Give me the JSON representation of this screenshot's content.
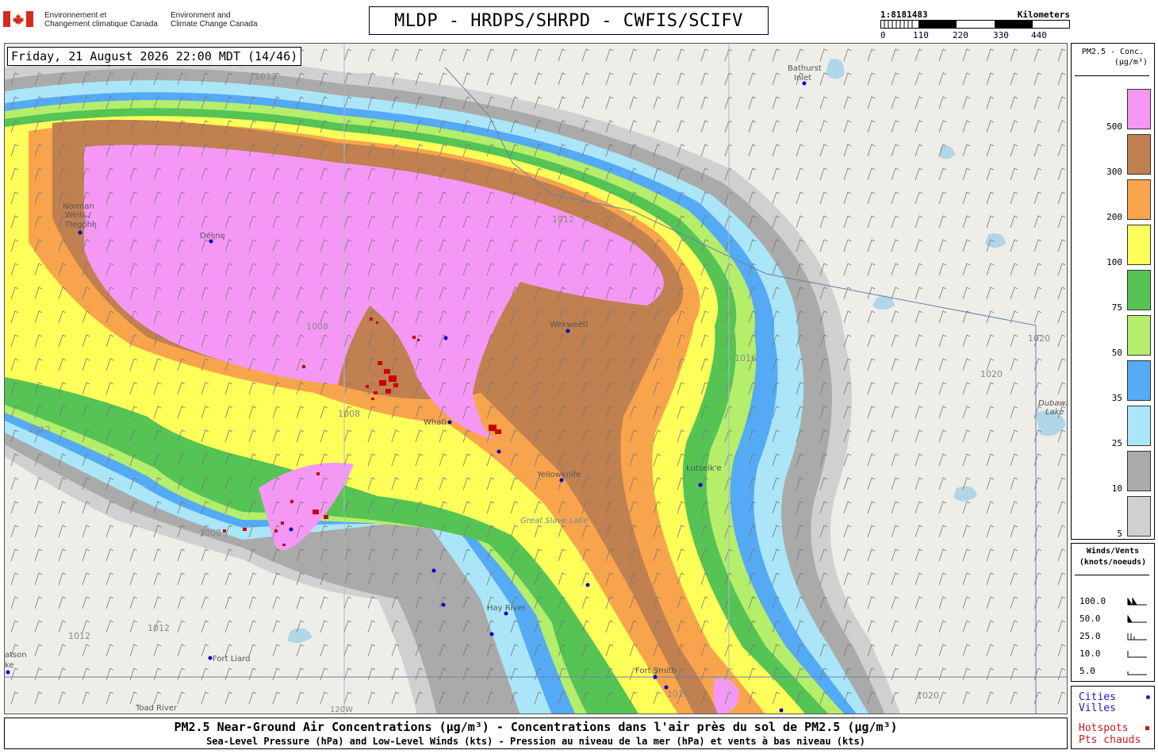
{
  "header": {
    "dept_fr_line1": "Environnement et",
    "dept_fr_line2": "Changement climatique Canada",
    "dept_en_line1": "Environment and",
    "dept_en_line2": "Climate Change Canada",
    "model_title": "MLDP - HRDPS/SHRPD - CWFIS/SCIFV"
  },
  "scale": {
    "ratio": "1:8181483",
    "unit": "Kilometers",
    "ticks": [
      "0",
      "110",
      "220",
      "330",
      "440"
    ]
  },
  "map": {
    "valid_time": "Friday, 21 August 2026 22:00 MDT (14/46)",
    "cities": [
      {
        "name": "Bathurst Inlet",
        "line1": "Bathurst",
        "line2": "Inlet"
      },
      {
        "name": "Norman Wells / Tłegǫ́hłı̨",
        "line1": "Norman",
        "line2": "Wells /",
        "line3": "Tłegǫ́hłı̨"
      },
      {
        "name": "Délı̨nę"
      },
      {
        "name": "Wekweètì"
      },
      {
        "name": "Whatì"
      },
      {
        "name": "Yellowknife"
      },
      {
        "name": "Łutselk'e"
      },
      {
        "name": "Hay River"
      },
      {
        "name": "Fort Liard"
      },
      {
        "name": "Fort Smith"
      },
      {
        "name": "Toad River"
      },
      {
        "name": "Dubawnt Lake",
        "line1": "Dubawnt",
        "line2": "Lake"
      },
      {
        "name": "Great Slave Lake"
      },
      {
        "name": "Watson Lake",
        "line1": "atson",
        "line2": "ke"
      }
    ],
    "isobars": [
      "1012",
      "1008",
      "1016",
      "1020"
    ],
    "meridian_label": "120W",
    "colors": {
      "land": "#efede8",
      "water": "#a9d3e8",
      "pm_5": "#d0d0d0",
      "pm_10": "#aaaaaa",
      "pm_25": "#aae6f8",
      "pm_35": "#55aaf5",
      "pm_50": "#b4ee6a",
      "pm_75": "#55c455",
      "pm_100": "#ffff5a",
      "pm_200": "#f8a44c",
      "pm_300": "#c08050",
      "pm_500": "#f598f5",
      "hotspot": "#cc0000",
      "city": "#0000cc"
    }
  },
  "legend": {
    "pm_title_line1": "PM2.5 - Conc.",
    "pm_title_line2": "(µg/m³)",
    "pm_levels": [
      {
        "value": "500",
        "color": "#f598f5"
      },
      {
        "value": "300",
        "color": "#c08050"
      },
      {
        "value": "200",
        "color": "#f8a44c"
      },
      {
        "value": "100",
        "color": "#ffff5a"
      },
      {
        "value": "75",
        "color": "#55c455"
      },
      {
        "value": "50",
        "color": "#b4ee6a"
      },
      {
        "value": "35",
        "color": "#55aaf5"
      },
      {
        "value": "25",
        "color": "#aae6f8"
      },
      {
        "value": "10",
        "color": "#aaaaaa"
      },
      {
        "value": "5",
        "color": "#d0d0d0"
      }
    ],
    "wind_title_line1": "Winds/Vents",
    "wind_title_line2": "(knots/noeuds)",
    "wind_levels": [
      "100.0",
      "50.0",
      "25.0",
      "10.0",
      "5.0"
    ],
    "cities_en": "Cities",
    "cities_fr": "Villes",
    "hotspots_en": "Hotspots",
    "hotspots_fr": "Pts chauds"
  },
  "footer": {
    "line1": "PM2.5 Near-Ground Air Concentrations (µg/m³) - Concentrations dans l'air près du sol de PM2.5 (µg/m³)",
    "line2": "Sea-Level Pressure (hPa) and Low-Level Winds (kts) - Pression au niveau de la mer (hPa) et vents à bas niveau (kts)"
  }
}
